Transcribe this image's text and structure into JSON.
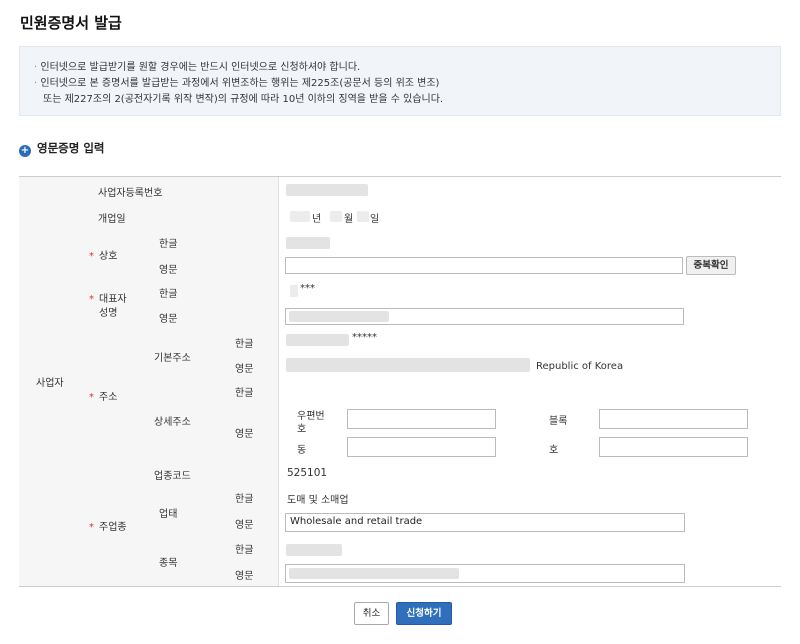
{
  "page": {
    "title": "민원증명서 발급"
  },
  "notice": {
    "lines": [
      "인터넷으로 발급받기를 원할 경우에는 반드시 인터넷으로 신청하셔야 합니다.",
      "인터넷으로 본 증명서를 발급받는 과정에서 위변조하는 행위는 제225조(공문서 등의 위조 변조)",
      "또는 제227조의 2(공전자기록 위작 변작)의 규정에 따라 10년 이하의 징역을 받을 수 있습니다."
    ]
  },
  "section": {
    "icon": "plus-circle-icon",
    "title": "영문증명 입력"
  },
  "labels": {
    "required_mark": "*",
    "business": "사업자",
    "reg_no": "사업자등록번호",
    "open_date": "개업일",
    "trade_name": "상호",
    "representative_1": "대표자",
    "representative_2": "성명",
    "address": "주소",
    "basic_address": "기본주소",
    "detail_address": "상세주소",
    "industry_code": "업종코드",
    "main_industry": "주업종",
    "business_type": "업태",
    "item": "종목",
    "korean": "한글",
    "english": "영문",
    "postal_code_1": "우편번",
    "postal_code_2": "호",
    "block": "블록",
    "dong": "동",
    "ho": "호"
  },
  "values": {
    "open_date_year_suffix": "년",
    "open_date_month_suffix": "월",
    "open_date_day_suffix": "일",
    "representative_korean": "***",
    "basic_address_korean": "*****",
    "basic_address_english_suffix": "Republic of Korea",
    "industry_code": "525101",
    "business_type_korean": "도매 및 소매업",
    "business_type_english": "Wholesale and retail trade"
  },
  "buttons": {
    "duplicate_check": "중복확인",
    "cancel": "취소",
    "apply": "신청하기"
  }
}
